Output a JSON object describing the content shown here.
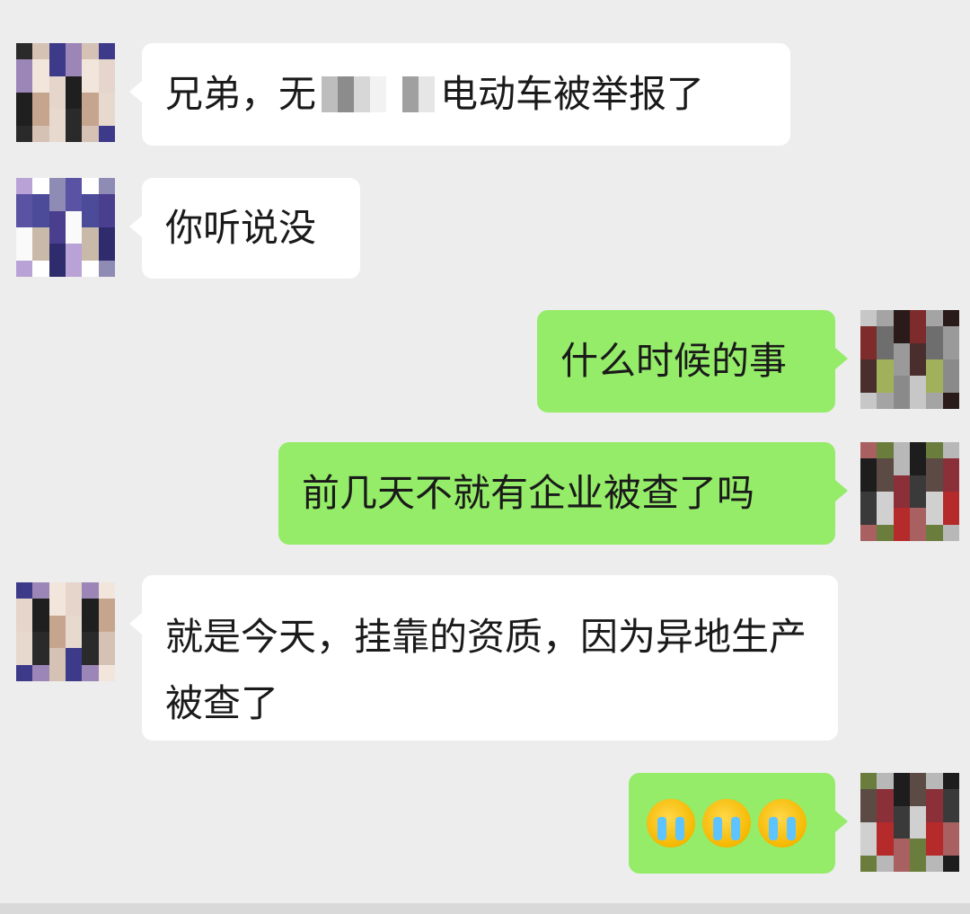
{
  "messages": [
    {
      "side": "left",
      "text_before": "兄弟，无",
      "text_after": "电动车被举报了"
    },
    {
      "side": "left",
      "text": "你听说没"
    },
    {
      "side": "right",
      "text": "什么时候的事"
    },
    {
      "side": "right",
      "text": "前几天不就有企业被查了吗"
    },
    {
      "side": "left",
      "text": "就是今天，挂靠的资质，因为异地生产被查了"
    },
    {
      "side": "right",
      "emoji": [
        "crying-face",
        "crying-face",
        "crying-face"
      ]
    }
  ],
  "colors": {
    "background": "#ededed",
    "left_bubble": "#ffffff",
    "right_bubble": "#95ec69",
    "text": "#1a1a1a"
  }
}
